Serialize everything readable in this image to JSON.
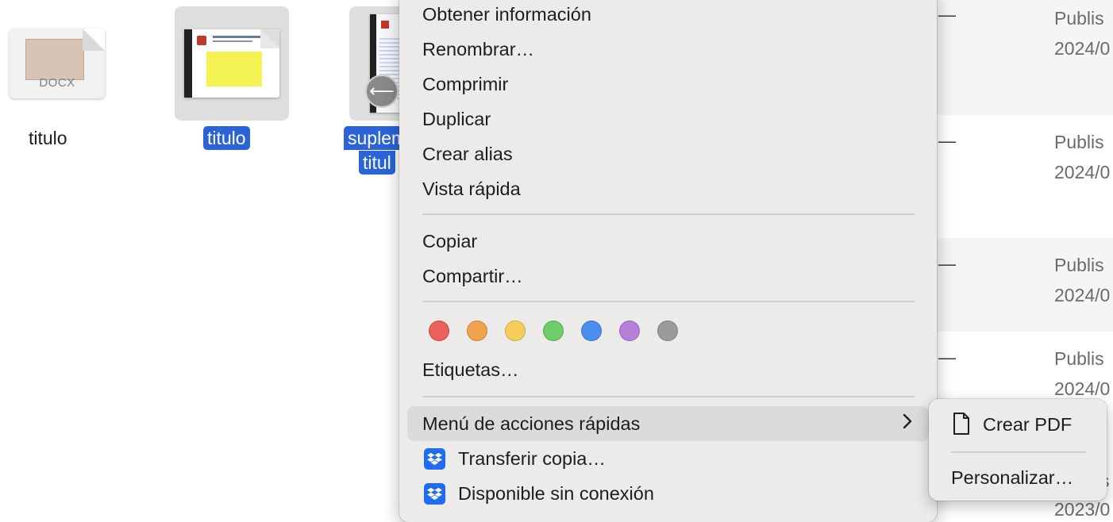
{
  "files": [
    {
      "label": "titulo",
      "type_badge": "DOCX",
      "selected": false
    },
    {
      "label": "titulo",
      "selected": true
    },
    {
      "label_line1": "suplem",
      "label_line2": "titul",
      "selected": true
    }
  ],
  "list_rows": [
    {
      "dash": "—",
      "line1": "Publis",
      "line2": "2024/0"
    },
    {
      "dash": "—",
      "line1": "Publis",
      "line2": "2024/0"
    },
    {
      "dash": "—",
      "line1": "Publis",
      "line2": "2024/0"
    },
    {
      "dash": "—",
      "line1": "Publis",
      "line2": "2024/0"
    },
    {
      "line1": "s",
      "line2": "2023/0"
    }
  ],
  "context_menu": {
    "items_group1": [
      "Obtener información",
      "Renombrar…",
      "Comprimir",
      "Duplicar",
      "Crear alias",
      "Vista rápida"
    ],
    "items_group2": [
      "Copiar",
      "Compartir…"
    ],
    "tags": [
      {
        "name": "red",
        "color": "#ec5f5c"
      },
      {
        "name": "orange",
        "color": "#f0a24c"
      },
      {
        "name": "yellow",
        "color": "#f6cf5b"
      },
      {
        "name": "green",
        "color": "#6fcc6a"
      },
      {
        "name": "blue",
        "color": "#4c8ef0"
      },
      {
        "name": "purple",
        "color": "#b57fdb"
      },
      {
        "name": "gray",
        "color": "#9b9b9d"
      }
    ],
    "tags_label": "Etiquetas…",
    "quick_actions_label": "Menú de acciones rápidas",
    "chevron": "›",
    "dropbox_items": [
      "Transferir copia…",
      "Disponible sin conexión"
    ]
  },
  "submenu": {
    "create_pdf": "Crear PDF",
    "customize": "Personalizar…"
  },
  "colors": {
    "selection": "#2a64d8",
    "dropbox": "#1f6bf2"
  }
}
